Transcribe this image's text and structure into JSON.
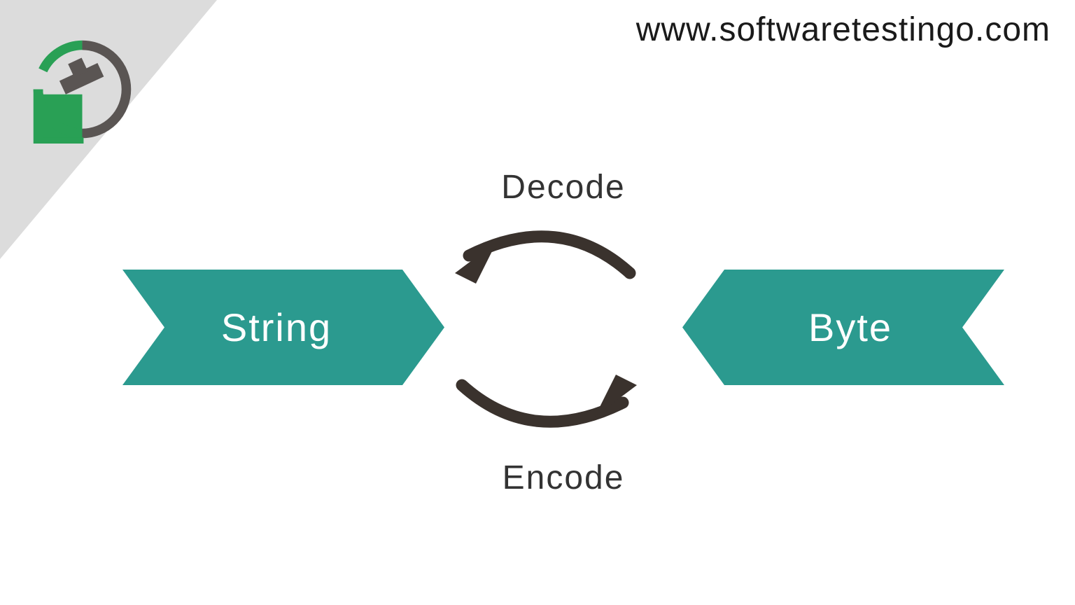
{
  "site_url": "www.softwaretestingo.com",
  "colors": {
    "teal": "#2b9a8f",
    "dark": "#3a322d",
    "logo_green": "#29a055",
    "logo_dark": "#5a5553",
    "triangle": "#dcdcdc"
  },
  "nodes": {
    "left": "String",
    "right": "Byte"
  },
  "labels": {
    "top": "Decode",
    "bottom": "Encode"
  }
}
